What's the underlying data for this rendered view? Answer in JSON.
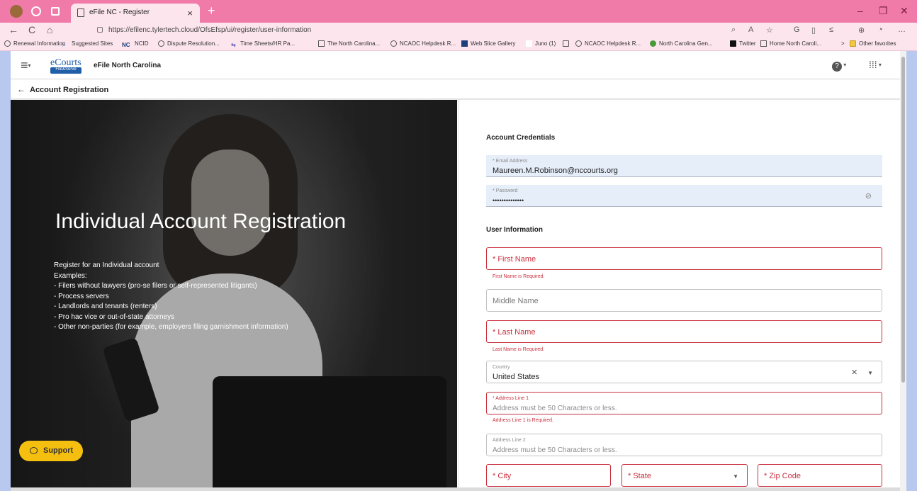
{
  "browser": {
    "tab_title": "eFile NC - Register",
    "tab_close": "×",
    "new_tab": "+",
    "url": "https://efilenc.tylertech.cloud/OfsEfsp/ui/register/user-information",
    "window_controls": {
      "minimize": "–",
      "restore": "❐",
      "close": "✕"
    },
    "nav": {
      "back": "←",
      "refresh": "C",
      "home": "⌂"
    },
    "toolbar_icons": [
      "zoom-icon",
      "read-aloud-icon",
      "favorite-icon",
      "extensions-icon",
      "split-screen-icon",
      "favorites-icon",
      "collections-icon",
      "profile-icon",
      "more-icon"
    ],
    "favorites": [
      "Renewal Information",
      "Suggested Sites",
      "NCID",
      "Dispute Resolution...",
      "Time Sheets/HR Pa...",
      "The North Carolina...",
      "NCAOC Helpdesk R...",
      "Web Slice Gallery",
      "Juno (1)",
      "",
      "NCAOC Helpdesk R...",
      "North Carolina Gen...",
      "Twitter",
      "Home North Caroli..."
    ],
    "favorites_more": ">",
    "other_favorites": "Other favorites"
  },
  "app": {
    "logo_text": "eCourts",
    "logo_sub": "File&Serve",
    "title": "eFile North Carolina",
    "help_icon": "?",
    "grid_icon": "⋮⋮⋮"
  },
  "subheader": {
    "back": "←",
    "title": "Account Registration"
  },
  "hero": {
    "title": "Individual Account Registration",
    "lines": [
      "Register for an Individual account",
      "Examples:",
      "- Filers without lawyers (pro-se filers or self-represented litigants)",
      "- Process servers",
      "- Landlords and tenants (renters)",
      "- Pro hac vice or out-of-state attorneys",
      "- Other non-parties (for example, employers filing garnishment information)"
    ],
    "support_label": "Support"
  },
  "form": {
    "credentials_heading": "Account Credentials",
    "email_label": "* Email Address",
    "email_value": "Maureen.M.Robinson@nccourts.org",
    "password_label": "* Password",
    "password_value": "••••••••••••••",
    "user_info_heading": "User Information",
    "first_name": "* First Name",
    "first_name_error": "First Name is Required.",
    "middle_name": "Middle Name",
    "last_name": "* Last Name",
    "last_name_error": "Last Name is Required.",
    "country_label": "Country",
    "country_value": "United States",
    "address1_label": "* Address Line 1",
    "address1_placeholder": "Address must be 50 Characters or less.",
    "address1_error": "Address Line 1 is Required.",
    "address2_label": "Address Line 2",
    "address2_placeholder": "Address must be 50 Characters or less.",
    "city": "* City",
    "state": "* State",
    "zip": "* Zip Code"
  },
  "colors": {
    "tabbar": "#f07aa8",
    "chrome_bg": "#fde5ee",
    "error": "#c9303e",
    "filled_bg": "#e6eefa",
    "support": "#f5bf0f",
    "brand": "#1f5ea8"
  }
}
